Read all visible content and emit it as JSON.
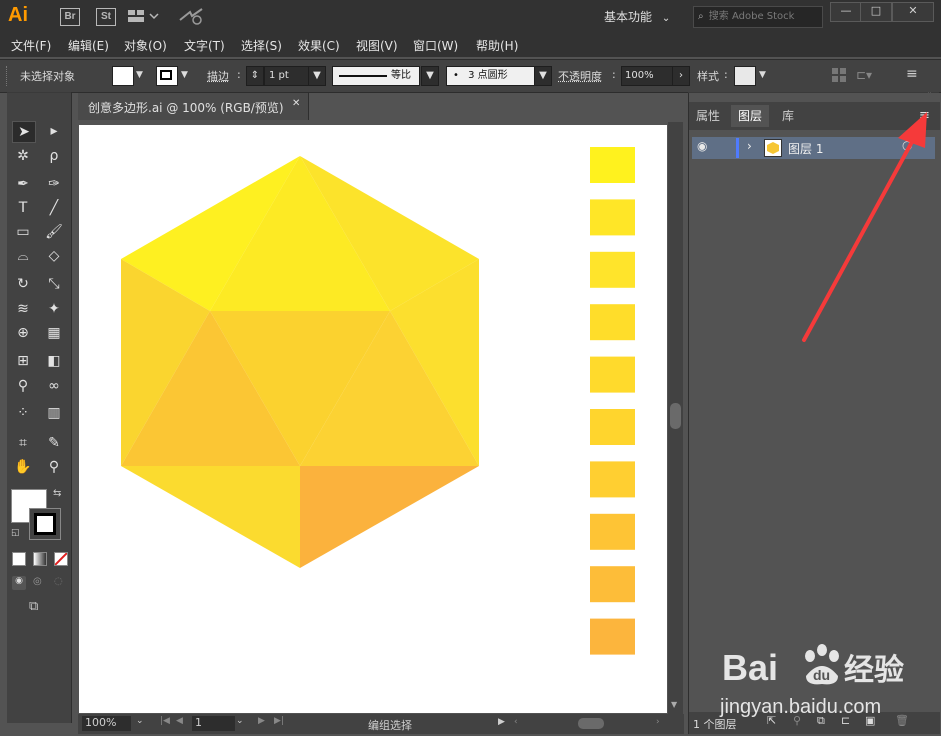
{
  "titlebar": {
    "app_logo": "Ai",
    "bridge_label": "Br",
    "stock_label": "St",
    "workspace_label": "基本功能",
    "search_placeholder": "搜索 Adobe Stock"
  },
  "menu": [
    "文件(F)",
    "编辑(E)",
    "对象(O)",
    "文字(T)",
    "选择(S)",
    "效果(C)",
    "视图(V)",
    "窗口(W)",
    "帮助(H)"
  ],
  "control": {
    "selection_status": "未选择对象",
    "stroke_label": "描边",
    "stroke_value": "1 pt",
    "stroke_profile": "等比",
    "brush_value": "3 点圆形",
    "opacity_label": "不透明度",
    "opacity_value": "100%",
    "style_label": "样式"
  },
  "document": {
    "tab_title": "创意多边形.ai @ 100% (RGB/预览)",
    "close_glyph": "✕"
  },
  "canvas": {
    "swatches": [
      "#fff21e",
      "#ffe627",
      "#ffe42b",
      "#ffdd2a",
      "#ffda2c",
      "#ffd52d",
      "#ffcf31",
      "#fec435",
      "#fdbd39",
      "#fcb53d"
    ],
    "hexagon_facets": [
      "#fef021",
      "#fdea24",
      "#fce32b",
      "#fad52f",
      "#fcdf2e",
      "#fbd22f",
      "#fbc634",
      "#fcd233",
      "#fde02d",
      "#fbdb2f",
      "#fbb23d",
      "#fcc036",
      "#f9b33e",
      "#fbcd30"
    ]
  },
  "statusbar": {
    "zoom": "100%",
    "artboard": "1",
    "tool_status": "编组选择"
  },
  "panel": {
    "tabs": [
      "属性",
      "图层",
      "库"
    ],
    "layer_name": "图层 1",
    "layer_count": "1 个图层"
  },
  "annotation": {
    "arrow_color": "#f53a3a"
  },
  "watermark": {
    "logo_text": "Bai du 经验",
    "url": "jingyan.baidu.com"
  }
}
